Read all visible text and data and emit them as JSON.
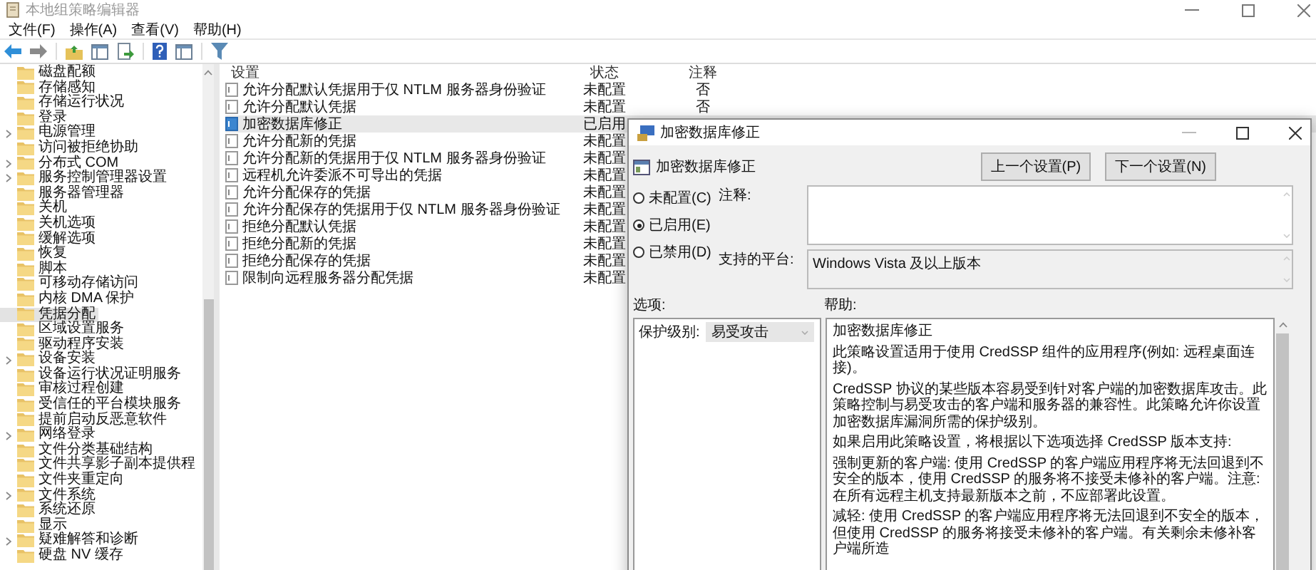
{
  "window": {
    "title": "本地组策略编辑器"
  },
  "menu": [
    "文件(F)",
    "操作(A)",
    "查看(V)",
    "帮助(H)"
  ],
  "tree": {
    "items": [
      {
        "label": "磁盘配额",
        "expandable": false,
        "selected": false
      },
      {
        "label": "存储感知",
        "expandable": false,
        "selected": false
      },
      {
        "label": "存储运行状况",
        "expandable": false,
        "selected": false
      },
      {
        "label": "登录",
        "expandable": false,
        "selected": false
      },
      {
        "label": "电源管理",
        "expandable": true,
        "selected": false
      },
      {
        "label": "访问被拒绝协助",
        "expandable": false,
        "selected": false
      },
      {
        "label": "分布式 COM",
        "expandable": true,
        "selected": false
      },
      {
        "label": "服务控制管理器设置",
        "expandable": true,
        "selected": false
      },
      {
        "label": "服务器管理器",
        "expandable": false,
        "selected": false
      },
      {
        "label": "关机",
        "expandable": false,
        "selected": false
      },
      {
        "label": "关机选项",
        "expandable": false,
        "selected": false
      },
      {
        "label": "缓解选项",
        "expandable": false,
        "selected": false
      },
      {
        "label": "恢复",
        "expandable": false,
        "selected": false
      },
      {
        "label": "脚本",
        "expandable": false,
        "selected": false
      },
      {
        "label": "可移动存储访问",
        "expandable": false,
        "selected": false
      },
      {
        "label": "内核 DMA 保护",
        "expandable": false,
        "selected": false
      },
      {
        "label": "凭据分配",
        "expandable": false,
        "selected": true
      },
      {
        "label": "区域设置服务",
        "expandable": false,
        "selected": false
      },
      {
        "label": "驱动程序安装",
        "expandable": false,
        "selected": false
      },
      {
        "label": "设备安装",
        "expandable": true,
        "selected": false
      },
      {
        "label": "设备运行状况证明服务",
        "expandable": false,
        "selected": false
      },
      {
        "label": "审核过程创建",
        "expandable": false,
        "selected": false
      },
      {
        "label": "受信任的平台模块服务",
        "expandable": false,
        "selected": false
      },
      {
        "label": "提前启动反恶意软件",
        "expandable": false,
        "selected": false
      },
      {
        "label": "网络登录",
        "expandable": true,
        "selected": false
      },
      {
        "label": "文件分类基础结构",
        "expandable": false,
        "selected": false
      },
      {
        "label": "文件共享影子副本提供程",
        "expandable": false,
        "selected": false
      },
      {
        "label": "文件夹重定向",
        "expandable": false,
        "selected": false
      },
      {
        "label": "文件系统",
        "expandable": true,
        "selected": false
      },
      {
        "label": "系统还原",
        "expandable": false,
        "selected": false
      },
      {
        "label": "显示",
        "expandable": false,
        "selected": false
      },
      {
        "label": "疑难解答和诊断",
        "expandable": true,
        "selected": false
      },
      {
        "label": "硬盘 NV 缓存",
        "expandable": false,
        "selected": false
      }
    ]
  },
  "list": {
    "columns": [
      "设置",
      "状态",
      "注释"
    ],
    "rows": [
      {
        "setting": "允许分配默认凭据用于仅 NTLM 服务器身份验证",
        "state": "未配置",
        "comment": "否",
        "selected": false
      },
      {
        "setting": "允许分配默认凭据",
        "state": "未配置",
        "comment": "否",
        "selected": false
      },
      {
        "setting": "加密数据库修正",
        "state": "已启用",
        "selected": true
      },
      {
        "setting": "允许分配新的凭据",
        "state": "未配置",
        "selected": false
      },
      {
        "setting": "允许分配新的凭据用于仅 NTLM 服务器身份验证",
        "state": "未配置",
        "selected": false
      },
      {
        "setting": "远程机允许委派不可导出的凭据",
        "state": "未配置",
        "selected": false
      },
      {
        "setting": "允许分配保存的凭据",
        "state": "未配置",
        "selected": false
      },
      {
        "setting": "允许分配保存的凭据用于仅 NTLM 服务器身份验证",
        "state": "未配置",
        "selected": false
      },
      {
        "setting": "拒绝分配默认凭据",
        "state": "未配置",
        "selected": false
      },
      {
        "setting": "拒绝分配新的凭据",
        "state": "未配置",
        "selected": false
      },
      {
        "setting": "拒绝分配保存的凭据",
        "state": "未配置",
        "selected": false
      },
      {
        "setting": "限制向远程服务器分配凭据",
        "state": "未配置",
        "selected": false
      }
    ]
  },
  "dialog": {
    "title": "加密数据库修正",
    "policy_name": "加密数据库修正",
    "buttons": [
      "上一个设置(P)",
      "下一个设置(N)"
    ],
    "options": [
      {
        "label": "未配置(C)",
        "selected": false
      },
      {
        "label": "已启用(E)",
        "selected": true
      },
      {
        "label": "已禁用(D)",
        "selected": false
      }
    ],
    "comment_label": "注释:",
    "platform_label": "支持的平台:",
    "platform": "Windows Vista 及以上版本",
    "options_label": "选项:",
    "help_label": "帮助:",
    "protection": {
      "label": "保护级别:",
      "value": "易受攻击"
    },
    "help": [
      "加密数据库修正",
      "此策略设置适用于使用 CredSSP 组件的应用程序(例如: 远程桌面连接)。",
      "CredSSP 协议的某些版本容易受到针对客户端的加密数据库攻击。此策略控制与易受攻击的客户端和服务器的兼容性。此策略允许你设置加密数据库漏洞所需的保护级别。",
      "如果启用此策略设置，将根据以下选项选择 CredSSP 版本支持:",
      "强制更新的客户端: 使用 CredSSP 的客户端应用程序将无法回退到不安全的版本，使用 CredSSP 的服务将不接受未修补的客户端。注意: 在所有远程主机支持最新版本之前，不应部署此设置。",
      "减轻: 使用 CredSSP 的客户端应用程序将无法回退到不安全的版本，但使用 CredSSP 的服务将接受未修补的客户端。有关剩余未修补客户端所造"
    ]
  }
}
